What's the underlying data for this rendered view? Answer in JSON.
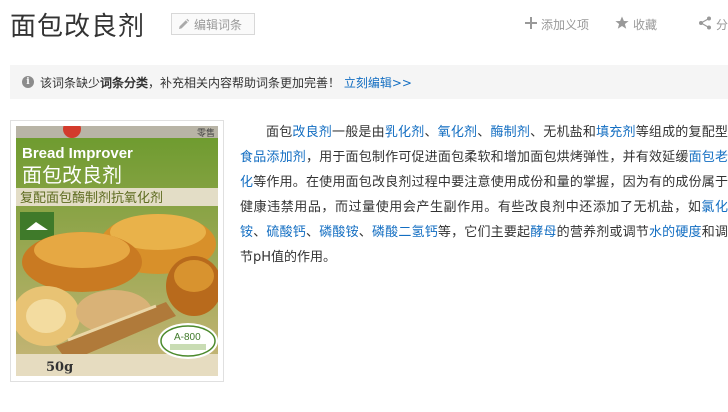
{
  "header": {
    "title": "面包改良剂",
    "edit_label": "编辑词条",
    "add_meaning_label": "添加义项",
    "favorite_label": "收藏",
    "share_label": "分"
  },
  "notice": {
    "prefix": "该词条缺少",
    "bold": "词条分类",
    "middle": "，补充相关内容帮助词条更加完善！",
    "link": "立刻编辑>>"
  },
  "image": {
    "brand_text": "Bread Improver",
    "name_text": "面包改良剂",
    "sub_text": "复配面包酶制剂抗氧化剂",
    "code_text": "A-800",
    "weight_text": "50g",
    "corner_text": "零售"
  },
  "article": {
    "segments": [
      {
        "t": "面包",
        "link": false
      },
      {
        "t": "改良剂",
        "link": true
      },
      {
        "t": "一般是由",
        "link": false
      },
      {
        "t": "乳化剂",
        "link": true
      },
      {
        "t": "、",
        "link": false
      },
      {
        "t": "氧化剂",
        "link": true
      },
      {
        "t": "、",
        "link": false
      },
      {
        "t": "酶制剂",
        "link": true
      },
      {
        "t": "、无机盐和",
        "link": false
      },
      {
        "t": "填充剂",
        "link": true
      },
      {
        "t": "等组成的复配型",
        "link": false
      },
      {
        "t": "食品添加剂",
        "link": true
      },
      {
        "t": "，用于面包制作可促进面包柔软和增加面包烘烤弹性，并有效延缓",
        "link": false
      },
      {
        "t": "面包老化",
        "link": true
      },
      {
        "t": "等作用。在使用面包改良剂过程中要注意使用成份和量的掌握，因为有的成份属于健康违禁用品，而过量使用会产生副作用。有些改良剂中还添加了无机盐，如",
        "link": false
      },
      {
        "t": "氯化铵",
        "link": true
      },
      {
        "t": "、",
        "link": false
      },
      {
        "t": "硫酸钙",
        "link": true
      },
      {
        "t": "、",
        "link": false
      },
      {
        "t": "磷酸铵",
        "link": true
      },
      {
        "t": "、",
        "link": false
      },
      {
        "t": "磷酸二氢钙",
        "link": true
      },
      {
        "t": "等，它们主要起",
        "link": false
      },
      {
        "t": "酵母",
        "link": true
      },
      {
        "t": "的营养剂或调节",
        "link": false
      },
      {
        "t": "水的硬度",
        "link": true
      },
      {
        "t": "和调节pH值的作用。",
        "link": false
      }
    ]
  },
  "colors": {
    "link": "#136ec2",
    "notice_bg": "#f5f5f5",
    "muted": "#999999"
  },
  "icons": {
    "edit": "pencil-icon",
    "add": "plus-icon",
    "favorite": "star-icon",
    "share": "share-icon",
    "info": "info-icon"
  }
}
